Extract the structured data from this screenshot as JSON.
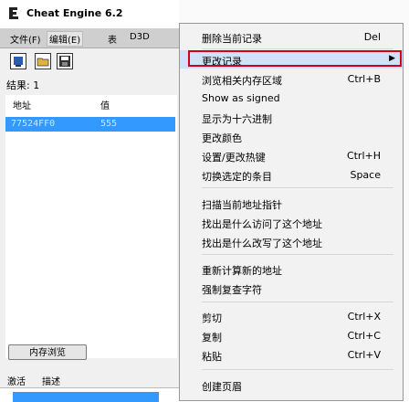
{
  "app": {
    "title": "Cheat Engine 6.2",
    "menu": [
      "文件(F)",
      "编辑(E)",
      "表",
      "D3D"
    ],
    "toolbar_icons": [
      "open-process-icon",
      "open-file-icon",
      "save-icon"
    ],
    "results_label": "结果: 1",
    "list_columns": [
      "地址",
      "值"
    ],
    "selected_row": {
      "address": "77524FF0",
      "value": "555"
    },
    "memory_view_button": "内存浏览",
    "bottom_columns": [
      "激活",
      "描述"
    ]
  },
  "context_menu": {
    "items": [
      {
        "label": "删除当前记录",
        "shortcut": "Del"
      },
      {
        "label": "更改记录",
        "submenu": true,
        "highlighted": true
      },
      {
        "label": "浏览相关内存区域",
        "shortcut": "Ctrl+B"
      },
      {
        "label": "Show as signed"
      },
      {
        "label": "显示为十六进制"
      },
      {
        "label": "更改颜色"
      },
      {
        "label": "设置/更改热键",
        "shortcut": "Ctrl+H"
      },
      {
        "label": "切换选定的条目",
        "shortcut": "Space"
      },
      {
        "label": "扫描当前地址指针"
      },
      {
        "label": "找出是什么访问了这个地址"
      },
      {
        "label": "找出是什么改写了这个地址"
      },
      {
        "label": "重新计算新的地址"
      },
      {
        "label": "强制复查字符"
      },
      {
        "label": "剪切",
        "shortcut": "Ctrl+X"
      },
      {
        "label": "复制",
        "shortcut": "Ctrl+C"
      },
      {
        "label": "粘贴",
        "shortcut": "Ctrl+V"
      },
      {
        "label": "创建页眉"
      }
    ],
    "submenu_arrow": "▶"
  },
  "colors": {
    "selection": "#3399ff",
    "highlight_box": "#d0021b"
  }
}
